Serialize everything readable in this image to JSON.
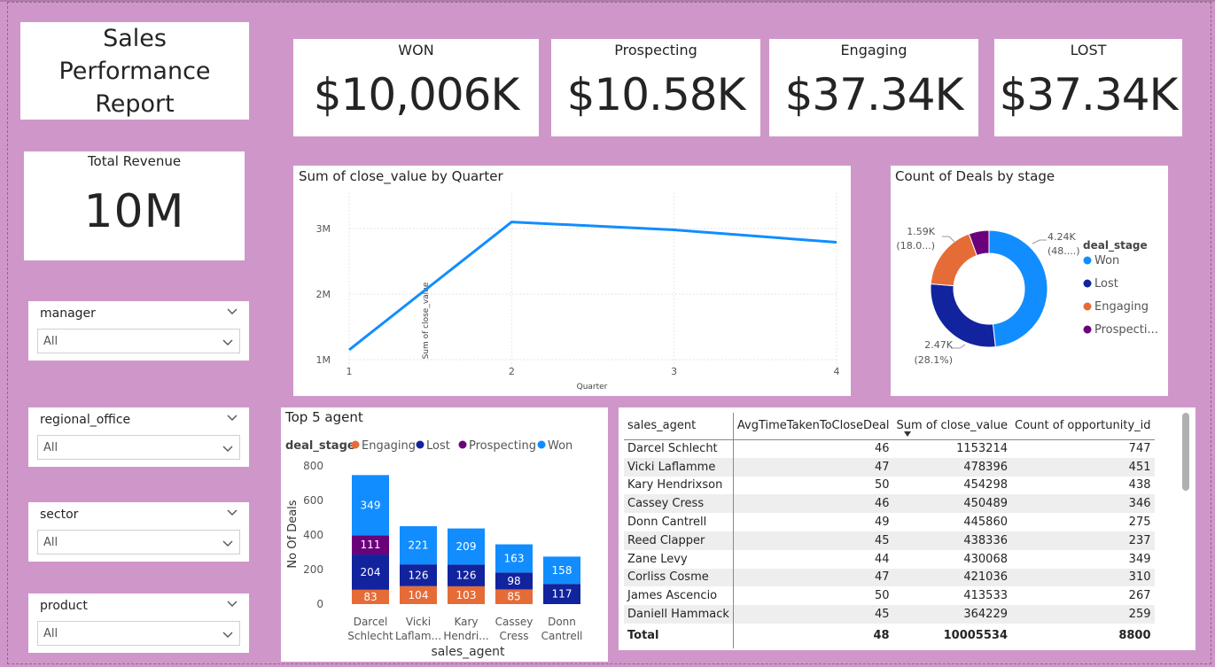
{
  "report": {
    "title": "Sales Performance Report"
  },
  "total_revenue": {
    "label": "Total Revenue",
    "value": "10M"
  },
  "kpis": [
    {
      "label": "WON",
      "value": "$10,006K"
    },
    {
      "label": "Prospecting",
      "value": "$10.58K"
    },
    {
      "label": "Engaging",
      "value": "$37.34K"
    },
    {
      "label": "LOST",
      "value": "$37.34K"
    }
  ],
  "slicers": [
    {
      "label": "manager",
      "value": "All"
    },
    {
      "label": "regional_office",
      "value": "All"
    },
    {
      "label": "sector",
      "value": "All"
    },
    {
      "label": "product",
      "value": "All"
    }
  ],
  "colors": {
    "background": "#CF97C9",
    "line": "#118DFF",
    "won": "#118DFF",
    "lost": "#12239E",
    "engaging": "#E66C37",
    "prospecting": "#6B007B"
  },
  "line_chart": {
    "title": "Sum of close_value by Quarter",
    "chart_data": {
      "type": "line",
      "title": "Sum of close_value by Quarter",
      "xlabel": "Quarter",
      "ylabel": "Sum of close_value",
      "x": [
        "1",
        "2",
        "3",
        "4"
      ],
      "values": [
        1150000,
        3100000,
        2980000,
        2790000
      ],
      "y_ticks": [
        "1M",
        "2M",
        "3M"
      ],
      "ylim": [
        1000000,
        3000000
      ]
    }
  },
  "donut_chart": {
    "title": "Count of Deals by stage",
    "legend_title": "deal_stage",
    "legend": [
      "Won",
      "Lost",
      "Engaging",
      "Prospecti..."
    ],
    "labels": {
      "won": [
        "4.24K",
        "(48....)"
      ],
      "lost": [
        "2.47K",
        "(28.1%)"
      ],
      "engaging": [
        "1.59K",
        "(18.0...)"
      ]
    },
    "chart_data": {
      "type": "pie",
      "title": "Count of Deals by stage",
      "categories": [
        "Won",
        "Lost",
        "Engaging",
        "Prospecting"
      ],
      "values": [
        4240,
        2470,
        1590,
        490
      ]
    }
  },
  "bar_chart": {
    "title": "Top 5 agent",
    "legend_title": "deal_stage",
    "legend": [
      "Engaging",
      "Lost",
      "Prospecting",
      "Won"
    ],
    "xlabel": "sales_agent",
    "ylabel": "No Of Deals",
    "y_ticks": [
      "0",
      "200",
      "400",
      "600",
      "800"
    ],
    "agent_labels": [
      [
        "Darcel",
        "Schlecht"
      ],
      [
        "Vicki",
        "Laflam..."
      ],
      [
        "Kary",
        "Hendri..."
      ],
      [
        "Cassey",
        "Cress"
      ],
      [
        "Donn",
        "Cantrell"
      ]
    ],
    "chart_data": {
      "type": "bar",
      "stacked": true,
      "title": "Top 5 agent",
      "xlabel": "sales_agent",
      "ylabel": "No Of Deals",
      "ylim": [
        0,
        800
      ],
      "categories": [
        "Darcel Schlecht",
        "Vicki Laflamme",
        "Kary Hendrixson",
        "Cassey Cress",
        "Donn Cantrell"
      ],
      "series": [
        {
          "name": "Engaging",
          "values": [
            83,
            104,
            103,
            85,
            0
          ]
        },
        {
          "name": "Lost",
          "values": [
            204,
            126,
            126,
            98,
            117
          ]
        },
        {
          "name": "Prospecting",
          "values": [
            111,
            0,
            0,
            0,
            0
          ]
        },
        {
          "name": "Won",
          "values": [
            349,
            221,
            209,
            163,
            158
          ]
        }
      ]
    }
  },
  "table": {
    "headers": [
      "sales_agent",
      "AvgTimeTakenToCloseDeal",
      "Sum of close_value",
      "Count of opportunity_id"
    ],
    "rows": [
      [
        "Darcel Schlecht",
        "46",
        "1153214",
        "747"
      ],
      [
        "Vicki Laflamme",
        "47",
        "478396",
        "451"
      ],
      [
        "Kary Hendrixson",
        "50",
        "454298",
        "438"
      ],
      [
        "Cassey Cress",
        "46",
        "450489",
        "346"
      ],
      [
        "Donn Cantrell",
        "49",
        "445860",
        "275"
      ],
      [
        "Reed Clapper",
        "45",
        "438336",
        "237"
      ],
      [
        "Zane Levy",
        "44",
        "430068",
        "349"
      ],
      [
        "Corliss Cosme",
        "47",
        "421036",
        "310"
      ],
      [
        "James Ascencio",
        "50",
        "413533",
        "267"
      ],
      [
        "Daniell Hammack",
        "45",
        "364229",
        "259"
      ]
    ],
    "total": [
      "Total",
      "48",
      "10005534",
      "8800"
    ]
  }
}
